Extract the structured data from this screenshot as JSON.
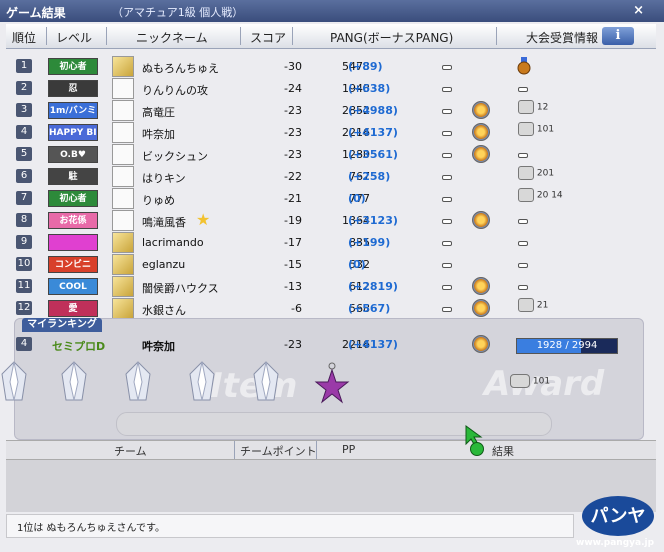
{
  "window": {
    "title": "ゲーム結果",
    "subtitle": "（アマチュア1級  個人戦）",
    "close": "×"
  },
  "header": {
    "rank": "順位",
    "level": "レベル",
    "nickname": "ニックネーム",
    "score": "スコア",
    "pang": "PANG(ボーナスPANG)",
    "award_info": "大会受賞情報",
    "info_icon": "i"
  },
  "rows": [
    {
      "rank": "1",
      "level": "初心者",
      "level_color": "#2d8a3a",
      "clan": true,
      "name": "ぬもろんちゅえ",
      "score": "-30",
      "pang": "5473",
      "bonus": "(+89)",
      "award": "bronze-medal"
    },
    {
      "rank": "2",
      "level": "忍",
      "level_color": "#3a3a3a",
      "clan": false,
      "name": "りんりんの攻",
      "score": "-24",
      "pang": "1943",
      "bonus": "(+638)",
      "award": "dash"
    },
    {
      "rank": "3",
      "level": "1m/バンミ",
      "level_color": "#3a6fd8",
      "clan": false,
      "name": "高竜圧",
      "score": "-23",
      "pang": "2852",
      "bonus": "(+4988)",
      "medal": true,
      "award": "12"
    },
    {
      "rank": "4",
      "level": "HAPPY BIRTHDAY",
      "level_color": "#4a6ad8",
      "clan": false,
      "name": "吽奈加",
      "score": "-23",
      "pang": "2216",
      "bonus": "(+4137)",
      "medal": true,
      "award": "101"
    },
    {
      "rank": "5",
      "level": "O.B♥",
      "level_color": "#555",
      "clan": false,
      "name": "ビックシュン",
      "score": "-23",
      "pang": "1280",
      "bonus": "(+3561)",
      "medal": true,
      "award": "dash"
    },
    {
      "rank": "6",
      "level": "駐",
      "level_color": "#444",
      "clan": false,
      "name": "はりキン",
      "score": "-22",
      "pang": "767",
      "bonus": "(+258)",
      "award": "201"
    },
    {
      "rank": "7",
      "level": "初心者",
      "level_color": "#2d8a3a",
      "clan": false,
      "name": "りゅめ",
      "score": "-21",
      "pang": "777",
      "bonus": "(0)",
      "award": "20 14"
    },
    {
      "rank": "8",
      "level": "お花係",
      "level_color": "#e86aa8",
      "clan": false,
      "name": "鳴滝風香",
      "star": true,
      "score": "-19",
      "pang": "1364",
      "bonus": "(+3123)",
      "medal": true,
      "award": "dash"
    },
    {
      "rank": "9",
      "level": "",
      "level_color": "#e040d0",
      "clan": true,
      "name": "lacrimando",
      "score": "-17",
      "pang": "835",
      "bonus": "(+199)",
      "award": "dash"
    },
    {
      "rank": "10",
      "level": "コンビニ",
      "level_color": "#d8402a",
      "clan": true,
      "name": "eglanzu",
      "score": "-15",
      "pang": "532",
      "bonus": "(0)",
      "award": "dash"
    },
    {
      "rank": "11",
      "level": "COOL",
      "level_color": "#3a8ad8",
      "clan": true,
      "name": "闇侯爵ハウクス",
      "score": "-13",
      "pang": "612",
      "bonus": "(+2819)",
      "medal": true,
      "award": "dash"
    },
    {
      "rank": "12",
      "level": "愛",
      "level_color": "#c0305a",
      "clan": true,
      "name": "水銀さん",
      "score": "-6",
      "pang": "568",
      "bonus": "(+567)",
      "medal": true,
      "award": "21"
    }
  ],
  "my_rank": {
    "tab": "マイランキング",
    "rank": "4",
    "level": "セミプロD",
    "name": "吽奈加",
    "score": "-23",
    "pang": "2216",
    "bonus": "(+4137)",
    "progress_text": "1928 / 2994",
    "progress": 0.644,
    "item_label": "Item",
    "award_label": "Award",
    "award_count": "101"
  },
  "team": {
    "team": "チーム",
    "team_point": "チームポイント",
    "pp": "PP",
    "result": "結果"
  },
  "status": "1位は ぬもろんちゅえさんです。",
  "logo": {
    "text": "パンヤ",
    "url": "www.pangya.jp"
  }
}
